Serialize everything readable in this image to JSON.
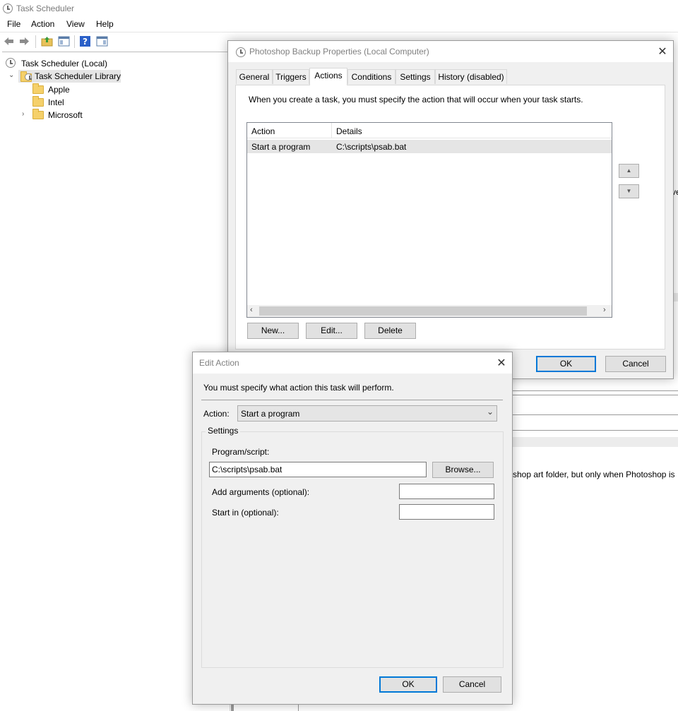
{
  "app": {
    "title": "Task Scheduler"
  },
  "menu": [
    "File",
    "Action",
    "View",
    "Help"
  ],
  "tree": {
    "root": "Task Scheduler (Local)",
    "library": "Task Scheduler Library",
    "folders": [
      "Apple",
      "Intel",
      "Microsoft"
    ]
  },
  "background_fragments": {
    "right_edge_text": "ve",
    "description_fragment": "shop art folder, but only when Photoshop is"
  },
  "properties_dialog": {
    "title": "Photoshop Backup Properties (Local Computer)",
    "tabs": [
      "General",
      "Triggers",
      "Actions",
      "Conditions",
      "Settings",
      "History (disabled)"
    ],
    "active_tab": "Actions",
    "instruction": "When you create a task, you must specify the action that will occur when your task starts.",
    "table": {
      "columns": [
        "Action",
        "Details"
      ],
      "rows": [
        {
          "action": "Start a program",
          "details": "C:\\scripts\\psab.bat"
        }
      ]
    },
    "buttons": {
      "new": "New...",
      "edit": "Edit...",
      "delete": "Delete",
      "ok": "OK",
      "cancel": "Cancel"
    }
  },
  "edit_action_dialog": {
    "title": "Edit Action",
    "instruction": "You must specify what action this task will perform.",
    "action_label": "Action:",
    "action_value": "Start a program",
    "settings_label": "Settings",
    "program_label": "Program/script:",
    "program_value": "C:\\scripts\\psab.bat",
    "browse": "Browse...",
    "args_label": "Add arguments (optional):",
    "args_value": "",
    "startin_label": "Start in (optional):",
    "startin_value": "",
    "ok": "OK",
    "cancel": "Cancel"
  },
  "colors": {
    "accent": "#0078d7",
    "selection": "#e5e5e5",
    "folder": "#f5d06a"
  }
}
